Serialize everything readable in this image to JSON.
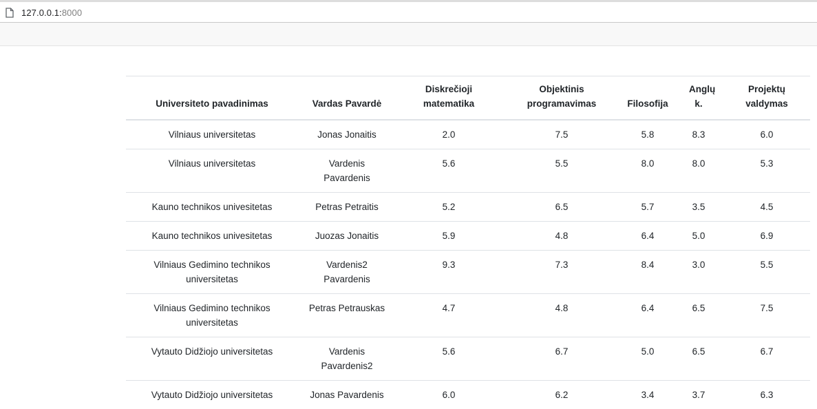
{
  "browser": {
    "url_host": "127.0.0.1:",
    "url_port": "8000"
  },
  "table": {
    "headers": [
      "Universiteto pavadinimas",
      "Vardas Pavardė",
      "Diskrečioji matematika",
      "Objektinis programavimas",
      "Filosofija",
      "Anglų k.",
      "Projektų valdymas"
    ],
    "rows": [
      [
        "Vilniaus universitetas",
        "Jonas Jonaitis",
        "2.0",
        "7.5",
        "5.8",
        "8.3",
        "6.0"
      ],
      [
        "Vilniaus universitetas",
        "Vardenis Pavardenis",
        "5.6",
        "5.5",
        "8.0",
        "8.0",
        "5.3"
      ],
      [
        "Kauno technikos univesitetas",
        "Petras Petraitis",
        "5.2",
        "6.5",
        "5.7",
        "3.5",
        "4.5"
      ],
      [
        "Kauno technikos univesitetas",
        "Juozas Jonaitis",
        "5.9",
        "4.8",
        "6.4",
        "5.0",
        "6.9"
      ],
      [
        "Vilniaus Gedimino technikos universitetas",
        "Vardenis2 Pavardenis",
        "9.3",
        "7.3",
        "8.4",
        "3.0",
        "5.5"
      ],
      [
        "Vilniaus Gedimino technikos universitetas",
        "Petras Petrauskas",
        "4.7",
        "4.8",
        "6.4",
        "6.5",
        "7.5"
      ],
      [
        "Vytauto Didžiojo universitetas",
        "Vardenis Pavardenis2",
        "5.6",
        "6.7",
        "5.0",
        "6.5",
        "6.7"
      ],
      [
        "Vytauto Didžiojo universitetas",
        "Jonas Pavardenis",
        "6.0",
        "6.2",
        "3.4",
        "3.7",
        "6.3"
      ]
    ]
  }
}
